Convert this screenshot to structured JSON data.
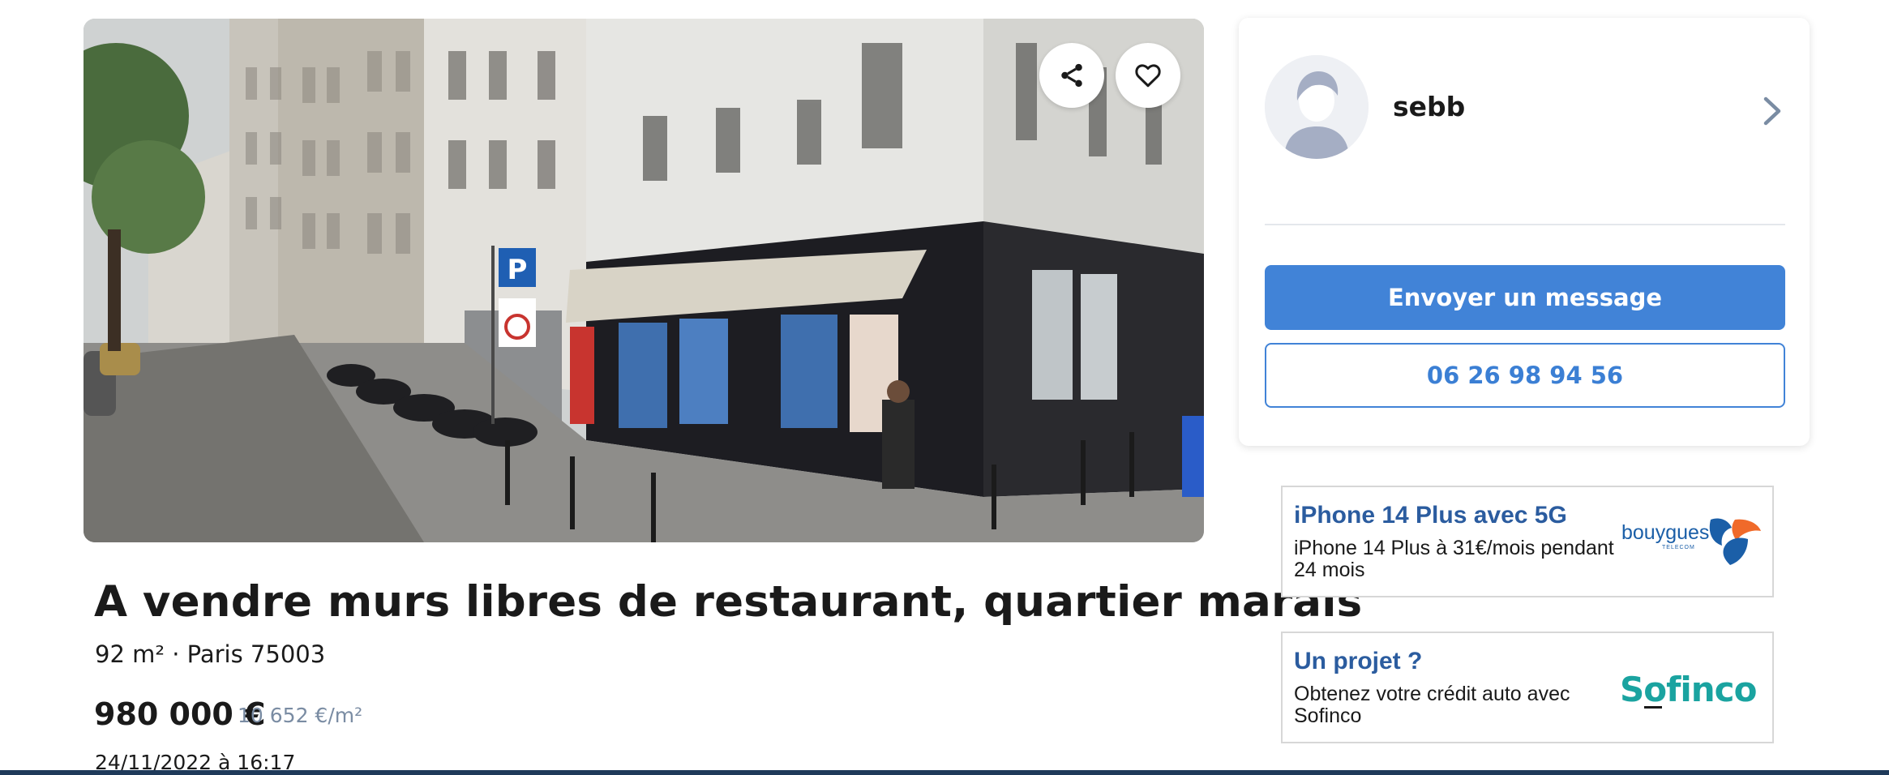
{
  "listing": {
    "title": "A vendre murs libres de restaurant, quartier marais",
    "subtitle": "92 m² · Paris 75003",
    "price": "980 000 €",
    "price_per_m2": "10 652 €/m²",
    "date": "24/11/2022 à 16:17"
  },
  "photo": {
    "share_icon": "share-icon",
    "favorite_icon": "heart-icon"
  },
  "seller": {
    "name": "sebb",
    "message_button": "Envoyer un message",
    "phone_button": "06 26 98 94 56"
  },
  "ads": [
    {
      "title": "iPhone 14 Plus avec 5G",
      "description": "iPhone 14 Plus à 31€/mois pendant 24 mois",
      "logo_text": "bouygues",
      "logo_subtext": "TELECOM"
    },
    {
      "title": "Un projet ?",
      "description": "Obtenez votre crédit auto avec Sofinco",
      "logo_text": "Sofinco"
    }
  ],
  "colors": {
    "accent_blue": "#4183d7",
    "ad_title_blue": "#2b5c9f",
    "price_per_m2_gray": "#7a8ca3",
    "sofinco_teal": "#1aa3a0",
    "bouygues_blue": "#1b5fa8",
    "bouygues_orange": "#f06a2a"
  }
}
